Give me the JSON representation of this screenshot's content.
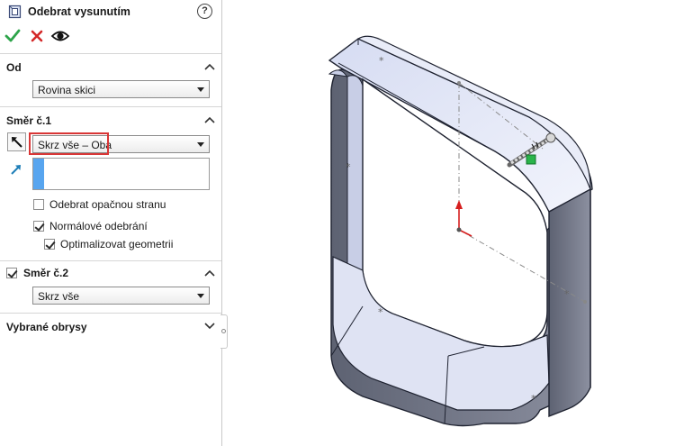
{
  "panel": {
    "title": "Odebrat vysunutím",
    "help_glyph": "?",
    "actions": {
      "ok": "ok-check-icon",
      "cancel": "cancel-x-icon",
      "preview": "eye-icon"
    }
  },
  "from_group": {
    "title": "Od",
    "value": "Rovina skici"
  },
  "direction1": {
    "title": "Směr č.1",
    "end_condition": "Skrz vše – Oba",
    "flip_side": "Odebrat opačnou stranu",
    "flip_side_checked": false,
    "normal_cut": "Normálové odebrání",
    "normal_cut_checked": true,
    "optimize": "Optimalizovat geometrii",
    "optimize_checked": true
  },
  "direction2": {
    "title": "Směr č.2",
    "checked": true,
    "end_condition": "Skrz vše"
  },
  "selected_contours": {
    "title": "Vybrané obrysy"
  },
  "colors": {
    "ok_green": "#2da44a",
    "cancel_red": "#d32727",
    "highlight_red": "#d93636",
    "selection_blue": "#58a5ef",
    "face_light": "#e4e8f7",
    "face_dark": "#6f7484"
  }
}
